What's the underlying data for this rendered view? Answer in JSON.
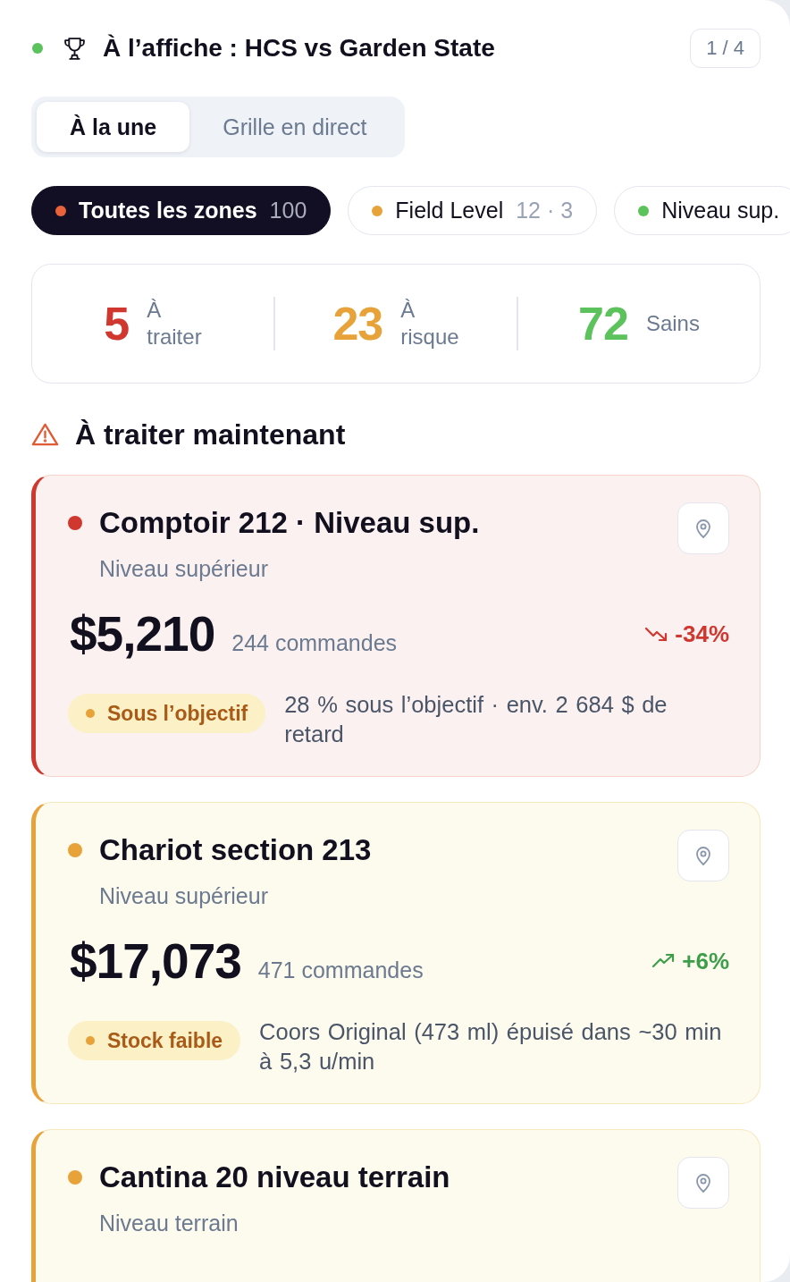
{
  "header": {
    "live": true,
    "title": "À l’affiche : HCS vs Garden State",
    "pager": "1 / 4"
  },
  "tabs": [
    {
      "label": "À la une",
      "selected": true
    },
    {
      "label": "Grille en direct",
      "selected": false
    }
  ],
  "zones": [
    {
      "label": "Toutes les zones",
      "count": "100",
      "color": "#e8633a",
      "selected": true
    },
    {
      "label": "Field Level",
      "count": "12 · 3",
      "color": "#e8a23a",
      "selected": false
    },
    {
      "label": "Niveau sup.",
      "color": "#5cc25c",
      "selected": false
    }
  ],
  "summary": [
    {
      "value": "5",
      "label": "À traiter",
      "color": "#d0372e"
    },
    {
      "value": "23",
      "label": "À risque",
      "color": "#e8a23a"
    },
    {
      "value": "72",
      "label": "Sains",
      "color": "#5cc25c"
    }
  ],
  "section": {
    "title": "À traiter maintenant"
  },
  "alerts": [
    {
      "kind": "critical",
      "name": "Comptoir 212 · Niveau sup.",
      "location": "Niveau supérieur",
      "revenue": "$5,210",
      "orders": "244 commandes",
      "trend": "-34%",
      "rising": false,
      "tag": "Sous l’objectif",
      "detail": "28 % sous l’objectif · env. 2 684 $ de retard"
    },
    {
      "kind": "warning",
      "name": "Chariot section 213",
      "location": "Niveau supérieur",
      "revenue": "$17,073",
      "orders": "471 commandes",
      "trend": "+6%",
      "rising": true,
      "tag": "Stock faible",
      "detail": "Coors Original (473 ml) épuisé dans ~30 min à 5,3 u/min"
    },
    {
      "kind": "warning",
      "name": "Cantina 20 niveau terrain",
      "location": "Niveau terrain"
    }
  ]
}
